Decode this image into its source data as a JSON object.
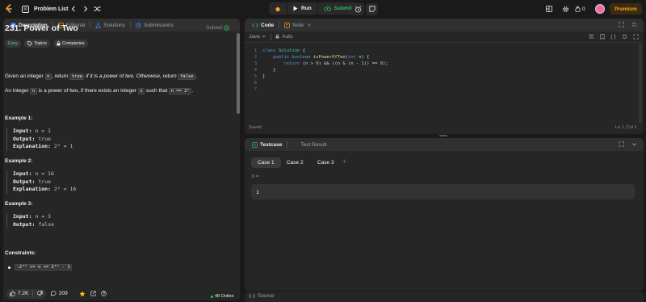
{
  "topbar": {
    "problem_list": "Problem List",
    "run": "Run",
    "submit": "Submit",
    "streak_count": "0",
    "premium": "Premium"
  },
  "left": {
    "tabs": [
      {
        "label": "Description",
        "icon": "book-icon"
      },
      {
        "label": "Editorial",
        "icon": "editorial-icon"
      },
      {
        "label": "Solutions",
        "icon": "flask-icon"
      },
      {
        "label": "Submissions",
        "icon": "history-icon"
      }
    ],
    "title": "231. Power of Two",
    "status": "Solved",
    "difficulty": "Easy",
    "topics": "Topics",
    "companies": "Companies",
    "desc1": {
      "a": "Given an integer",
      "n": "n",
      "b": ", return",
      "true": "true",
      "c": "if it is a power of two. Otherwise, return",
      "false": "false",
      "d": "."
    },
    "desc2": {
      "a": "An integer",
      "n": "n",
      "b": "is a power of two, if there exists an integer",
      "x": "x",
      "c": "such that",
      "formula": "n == 2ˣ",
      "d": "."
    },
    "examples": [
      {
        "heading": "Example 1:",
        "input": "n = 1",
        "output": "true",
        "explanation": "2⁰ = 1"
      },
      {
        "heading": "Example 2:",
        "input": "n = 16",
        "output": "true",
        "explanation": "2⁴ = 16"
      },
      {
        "heading": "Example 3:",
        "input": "n = 3",
        "output": "false"
      }
    ],
    "labels": {
      "input": "Input:",
      "output": "Output:",
      "explanation": "Explanation:"
    },
    "constraints_heading": "Constraints:",
    "constraint": "-2³¹ <= n <= 2³¹ - 1",
    "footer": {
      "likes": "7.2K",
      "comments": "209",
      "online": "48 Online"
    }
  },
  "code": {
    "tabs": [
      {
        "label": "Code",
        "icon": "code-icon"
      },
      {
        "label": "Note",
        "icon": "note-icon"
      }
    ],
    "language": "Java",
    "mode": "Auto",
    "lines": [
      "1",
      "2",
      "3",
      "4",
      "5",
      "6",
      "7"
    ],
    "status": "Saved",
    "cursor": "Ln 1, Col 1"
  },
  "test": {
    "tabs": [
      {
        "label": "Testcase",
        "icon": "check-square-icon"
      },
      {
        "label": "Test Result",
        "icon": "terminal-icon"
      }
    ],
    "cases": [
      "Case 1",
      "Case 2",
      "Case 3"
    ],
    "param_label": "n =",
    "param_value": "1",
    "source": "Source"
  },
  "colors": {
    "accent_orange": "#ffa116",
    "easy": "#46c6c2",
    "success": "#2cbb5d"
  }
}
